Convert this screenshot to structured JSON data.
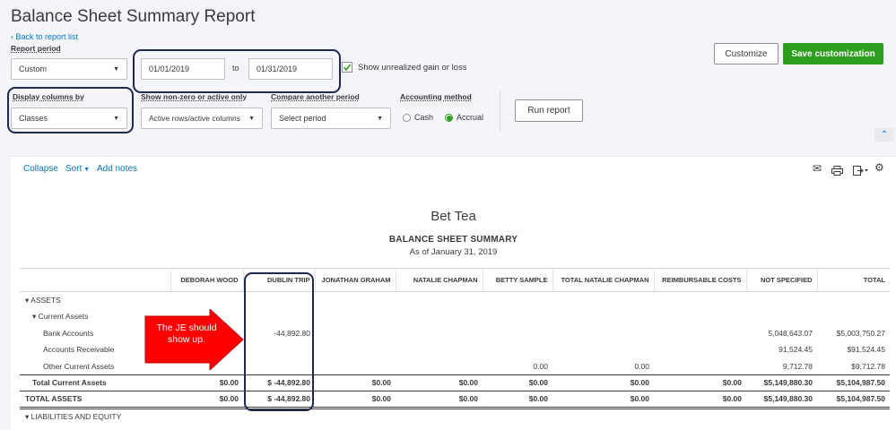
{
  "header": {
    "title": "Balance Sheet Summary Report",
    "back_link": "Back to report list"
  },
  "filters": {
    "report_period_label": "Report period",
    "report_period_value": "Custom",
    "date_from": "01/01/2019",
    "date_to_sep": "to",
    "date_to": "01/31/2019",
    "unrealized_label": "Show unrealized gain or loss",
    "display_columns_label": "Display columns by",
    "display_columns_value": "Classes",
    "nonzero_label": "Show non-zero or active only",
    "nonzero_value": "Active rows/active columns",
    "compare_label": "Compare another period",
    "compare_value": "Select period",
    "accounting_label": "Accounting method",
    "cash_label": "Cash",
    "accrual_label": "Accrual",
    "run_report": "Run report",
    "customize": "Customize",
    "save_customization": "Save customization"
  },
  "toolbar": {
    "collapse": "Collapse",
    "sort": "Sort",
    "add_notes": "Add notes"
  },
  "report": {
    "company": "Bet Tea",
    "title": "BALANCE SHEET SUMMARY",
    "subtitle": "As of January 31, 2019",
    "columns": [
      "",
      "DEBORAH WOOD",
      "DUBLIN TRIP",
      "JONATHAN GRAHAM",
      "NATALIE CHAPMAN",
      "BETTY SAMPLE",
      "TOTAL NATALIE CHAPMAN",
      "REIMBURSABLE COSTS",
      "NOT SPECIFIED",
      "TOTAL"
    ],
    "rows": {
      "assets": [
        "▾ ASSETS",
        "",
        "",
        "",
        "",
        "",
        "",
        "",
        "",
        ""
      ],
      "current_assets": [
        "▾ Current Assets",
        "",
        "",
        "",
        "",
        "",
        "",
        "",
        "",
        ""
      ],
      "bank": [
        "Bank Accounts",
        "",
        "-44,892.80",
        "",
        "",
        "",
        "",
        "",
        "5,048,643.07",
        "$5,003,750.27"
      ],
      "ar": [
        "Accounts Receivable",
        "",
        "",
        "",
        "",
        "",
        "",
        "",
        "91,524.45",
        "$91,524.45"
      ],
      "oca": [
        "Other Current Assets",
        "",
        "",
        "",
        "",
        "0.00",
        "0.00",
        "",
        "9,712.78",
        "$9,712.78"
      ],
      "tca": [
        "Total Current Assets",
        "$0.00",
        "$ -44,892.80",
        "$0.00",
        "$0.00",
        "$0.00",
        "$0.00",
        "$0.00",
        "$5,149,880.30",
        "$5,104,987.50"
      ],
      "ta": [
        "TOTAL ASSETS",
        "$0.00",
        "$ -44,892.80",
        "$0.00",
        "$0.00",
        "$0.00",
        "$0.00",
        "$0.00",
        "$5,149,880.30",
        "$5,104,987.50"
      ],
      "le": [
        "▾ LIABILITIES AND EQUITY",
        "",
        "",
        "",
        "",
        "",
        "",
        "",
        "",
        ""
      ]
    }
  },
  "annotation": {
    "text": "The JE should show up."
  },
  "colors": {
    "accent_green": "#2ca01c",
    "link_blue": "#0077c5",
    "annotation_red": "#ff0000",
    "highlight_navy": "#1b2a4e"
  }
}
